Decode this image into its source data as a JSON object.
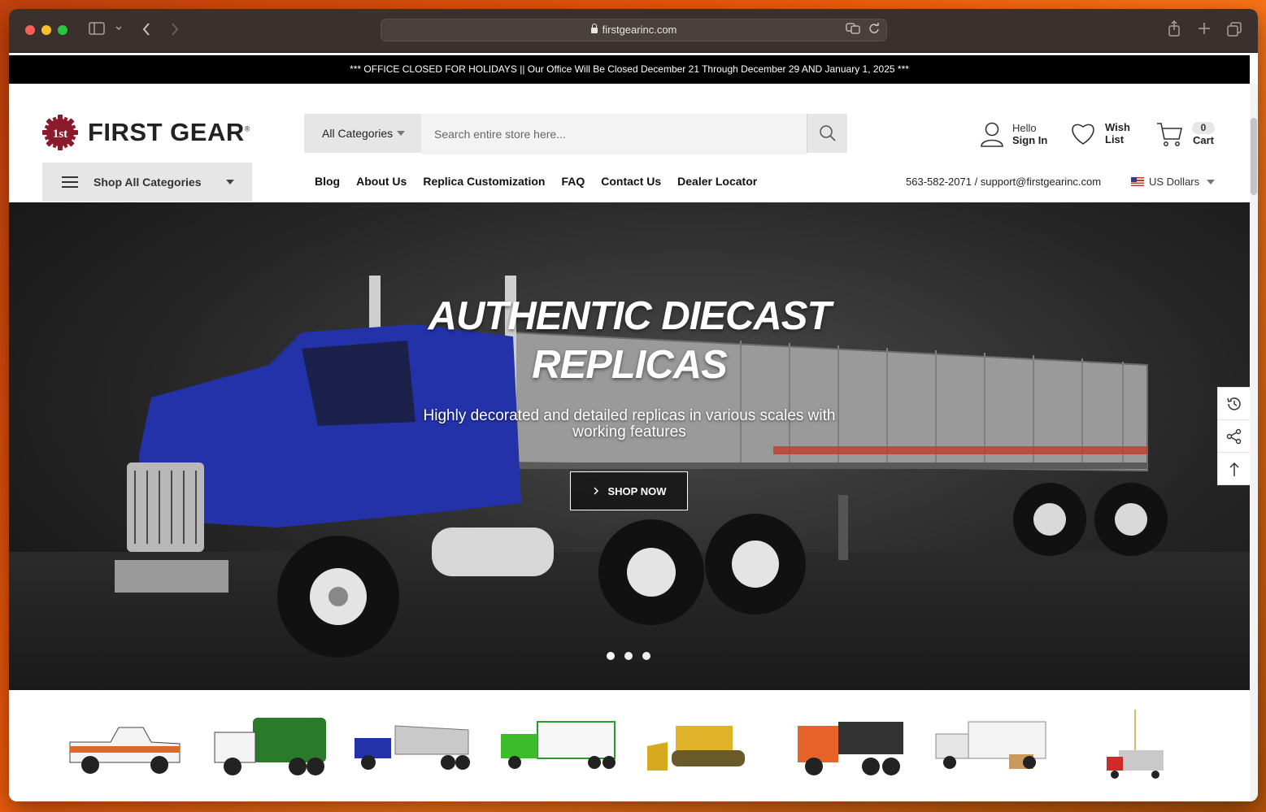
{
  "browser": {
    "url": "firstgearinc.com"
  },
  "announcement": "*** OFFICE CLOSED FOR HOLIDAYS || Our Office Will Be Closed December 21 Through December 29 AND January 1, 2025 ***",
  "header": {
    "logo_mark": "1st",
    "logo_text": "FIRST GEAR",
    "logo_reg": "®",
    "search": {
      "category_label": "All Categories",
      "placeholder": "Search entire store here..."
    },
    "account": {
      "line1": "Hello",
      "line2": "Sign In"
    },
    "wishlist": {
      "line1": "Wish",
      "line2": "List"
    },
    "cart": {
      "count": "0",
      "label": "Cart"
    }
  },
  "navbar": {
    "shop_all_label": "Shop All Categories",
    "links": [
      "Blog",
      "About Us",
      "Replica Customization",
      "FAQ",
      "Contact Us",
      "Dealer Locator"
    ],
    "contact": "563-582-2071 / support@firstgearinc.com",
    "currency": "US Dollars"
  },
  "hero": {
    "title_line1": "AUTHENTIC DIECAST",
    "title_line2": "REPLICAS",
    "subtitle_line1": "Highly decorated and detailed replicas in various scales with",
    "subtitle_line2": "working features",
    "cta": "SHOP NOW",
    "slide_count": 3,
    "active_slide": 1
  },
  "side_tools": [
    "history-icon",
    "share-icon",
    "back-to-top-icon"
  ],
  "colors": {
    "brand_maroon": "#8b1a2b",
    "announcement_bg": "#000000",
    "truck_blue": "#2332a8"
  }
}
